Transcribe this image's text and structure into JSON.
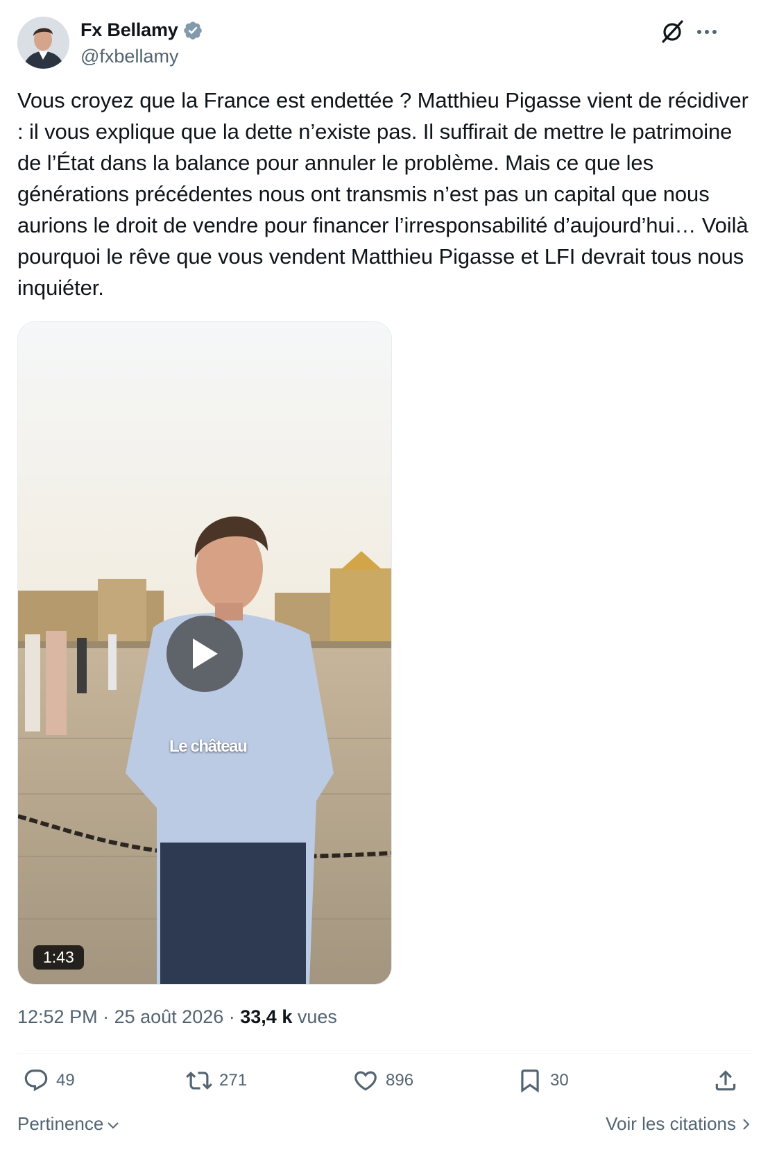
{
  "author": {
    "name": "Fx Bellamy",
    "handle": "@fxbellamy"
  },
  "tweet": {
    "text": "Vous croyez que la France est endettée ? Matthieu Pigasse vient de récidiver : il vous explique que la dette n’existe pas. Il suffirait de mettre le patrimoine de l’État dans la balance pour annuler le problème. Mais ce que les générations précédentes nous ont transmis n’est pas un capital que nous aurions le droit de vendre pour financer l’irresponsabilité d’aujourd’hui… Voilà pourquoi le rêve que vous vendent Matthieu Pigasse et LFI devrait tous nous inquiéter."
  },
  "video": {
    "overlay_caption": "Le château",
    "duration": "1:43"
  },
  "meta": {
    "time": "12:52 PM",
    "date": "25 août 2026",
    "views_count": "33,4 k",
    "views_label": "vues"
  },
  "actions": {
    "replies": "49",
    "reposts": "271",
    "likes": "896",
    "bookmarks": "30"
  },
  "footer": {
    "sort_label": "Pertinence",
    "quotes_label": "Voir les citations"
  },
  "colors": {
    "verified": "#829aab",
    "secondary_text": "#536471"
  }
}
